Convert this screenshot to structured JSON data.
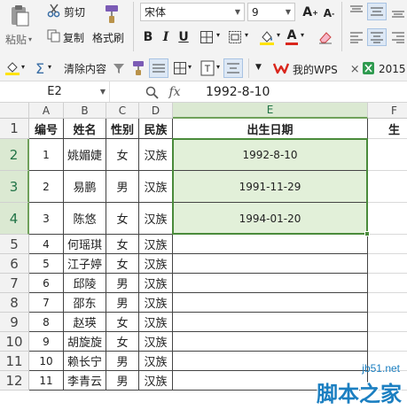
{
  "ribbon": {
    "paste_label": "粘贴",
    "cut_label": "剪切",
    "copy_label": "复制",
    "format_painter_label": "格式刷",
    "font_name": "宋体",
    "font_size": "9",
    "bold_label": "B",
    "italic_label": "I",
    "underline_label": "U",
    "clear_content_label": "清除内容"
  },
  "tabs": [
    {
      "label": "我的WPS"
    },
    {
      "label": "2015"
    }
  ],
  "formula_bar": {
    "name_box": "E2",
    "fx_label": "fx",
    "formula": "1992-8-10"
  },
  "columns": [
    "A",
    "B",
    "C",
    "D",
    "E",
    "F"
  ],
  "rows": [
    "1",
    "2",
    "3",
    "4",
    "5",
    "6",
    "7",
    "8",
    "9",
    "10",
    "11",
    "12"
  ],
  "table": {
    "headers": [
      "编号",
      "姓名",
      "性别",
      "民族",
      "出生日期",
      "生"
    ],
    "records": [
      {
        "id": "1",
        "name": "姚媚婕",
        "gender": "女",
        "ethnic": "汉族",
        "birth": "1992-8-10"
      },
      {
        "id": "2",
        "name": "易鹏",
        "gender": "男",
        "ethnic": "汉族",
        "birth": "1991-11-29"
      },
      {
        "id": "3",
        "name": "陈悠",
        "gender": "女",
        "ethnic": "汉族",
        "birth": "1994-01-20"
      },
      {
        "id": "4",
        "name": "何瑶琪",
        "gender": "女",
        "ethnic": "汉族",
        "birth": ""
      },
      {
        "id": "5",
        "name": "江子婷",
        "gender": "女",
        "ethnic": "汉族",
        "birth": ""
      },
      {
        "id": "6",
        "name": "邱陵",
        "gender": "男",
        "ethnic": "汉族",
        "birth": ""
      },
      {
        "id": "7",
        "name": "邵东",
        "gender": "男",
        "ethnic": "汉族",
        "birth": ""
      },
      {
        "id": "8",
        "name": "赵瑛",
        "gender": "女",
        "ethnic": "汉族",
        "birth": ""
      },
      {
        "id": "9",
        "name": "胡旋旋",
        "gender": "女",
        "ethnic": "汉族",
        "birth": ""
      },
      {
        "id": "10",
        "name": "赖长宁",
        "gender": "男",
        "ethnic": "汉族",
        "birth": ""
      },
      {
        "id": "11",
        "name": "李青云",
        "gender": "男",
        "ethnic": "汉族",
        "birth": ""
      }
    ]
  },
  "watermark": {
    "site": "jb51.net",
    "name": "脚本之家"
  },
  "colors": {
    "selection_border": "#4a8b3b",
    "selection_fill": "#e2f0d9",
    "header_selected": "#dbe9d2",
    "wps_red": "#d9261c"
  }
}
